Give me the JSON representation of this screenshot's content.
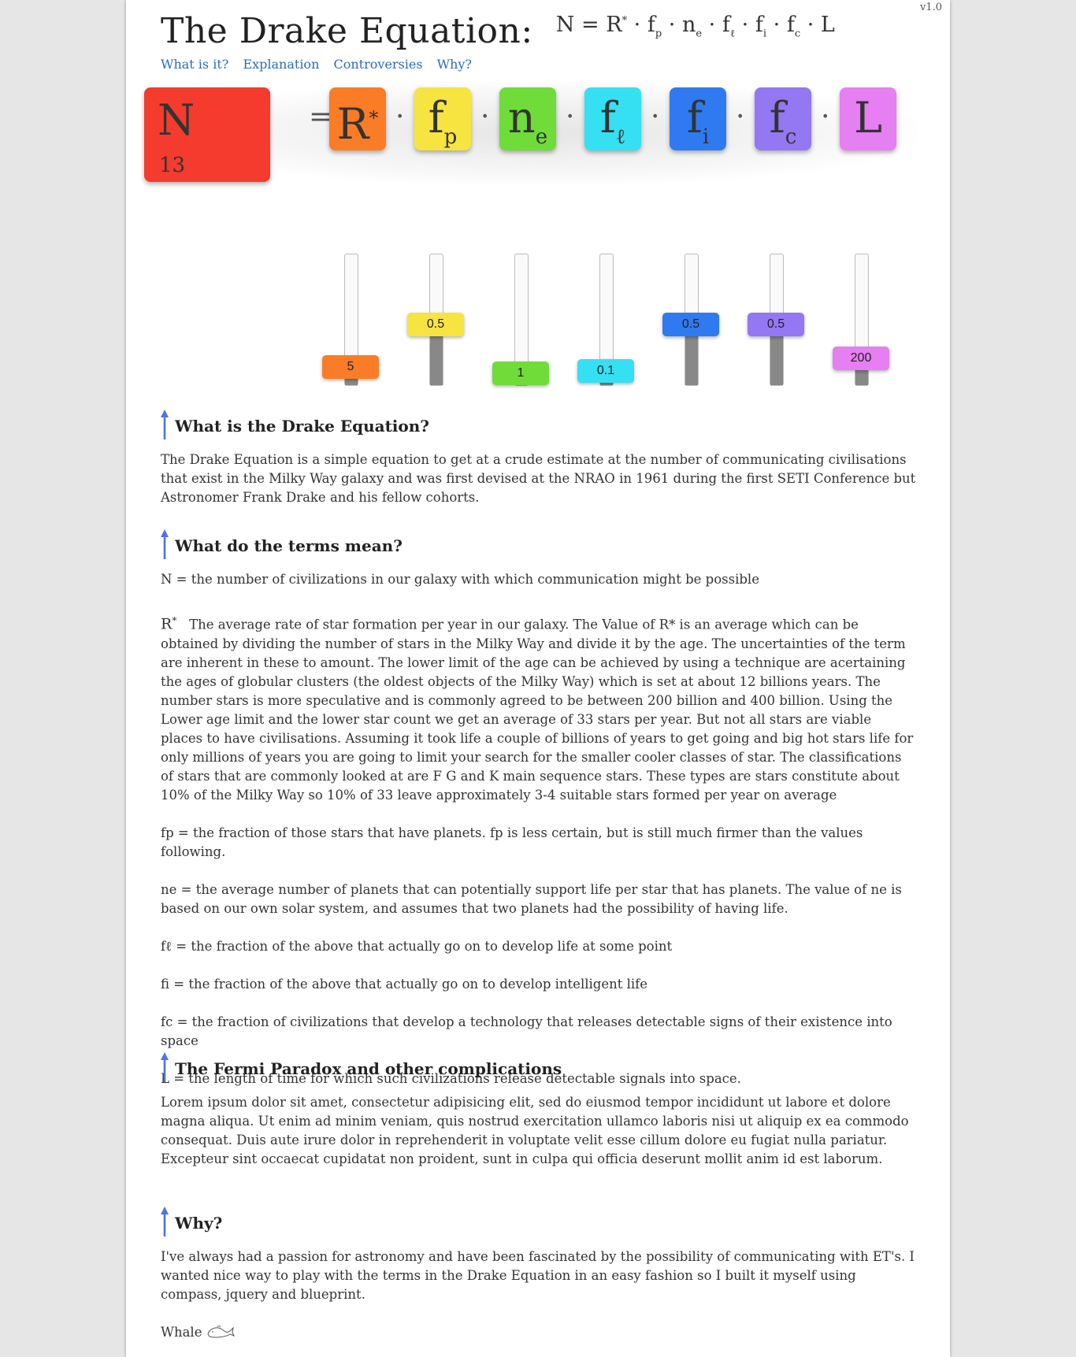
{
  "version": "v1.0",
  "header": {
    "title": "The Drake Equation:",
    "formula": {
      "n": "N",
      "eq": "=",
      "r": "R",
      "star": "*",
      "dot": "·",
      "f": "f",
      "p": "p",
      "nn": "n",
      "e": "e",
      "l": "ℓ",
      "i": "i",
      "c": "c",
      "L": "L"
    }
  },
  "nav": [
    "What is it?",
    "Explanation",
    "Controversies",
    "Why?"
  ],
  "equation": {
    "n_label": "N",
    "n_value": "13",
    "equals": "=",
    "dot": "·",
    "terms": [
      {
        "key": "r",
        "main": "R",
        "sup": "*",
        "sub": "",
        "color": "#fb7c26"
      },
      {
        "key": "fp",
        "main": "f",
        "sup": "",
        "sub": "p",
        "color": "#f7e440"
      },
      {
        "key": "ne",
        "main": "n",
        "sup": "",
        "sub": "e",
        "color": "#6fdc3a"
      },
      {
        "key": "fl",
        "main": "f",
        "sup": "",
        "sub": "ℓ",
        "color": "#34e0f2"
      },
      {
        "key": "fi",
        "main": "f",
        "sup": "",
        "sub": "i",
        "color": "#2f7af0"
      },
      {
        "key": "fc",
        "main": "f",
        "sup": "",
        "sub": "c",
        "color": "#9477f3"
      },
      {
        "key": "L",
        "main": "L",
        "sup": "",
        "sub": "",
        "color": "#e57ff2"
      }
    ]
  },
  "sliders": [
    {
      "key": "r",
      "value": "5",
      "color": "#fb7c26",
      "level": 0.06
    },
    {
      "key": "fp",
      "value": "0.5",
      "color": "#f7e440",
      "level": 0.45
    },
    {
      "key": "ne",
      "value": "1",
      "color": "#6fdc3a",
      "level": 0.0
    },
    {
      "key": "fl",
      "value": "0.1",
      "color": "#34e0f2",
      "level": 0.02
    },
    {
      "key": "fi",
      "value": "0.5",
      "color": "#2f7af0",
      "level": 0.45
    },
    {
      "key": "fc",
      "value": "0.5",
      "color": "#9477f3",
      "level": 0.45
    },
    {
      "key": "L",
      "value": "200",
      "color": "#e57ff2",
      "level": 0.14
    }
  ],
  "sections": {
    "what": {
      "heading": "What is the Drake Equation?",
      "body": "The Drake Equation is a simple equation to get at a crude estimate at the number of communicating civilisations that exist in the Milky Way galaxy and was first devised at the NRAO in 1961 during the first SETI Conference but Astronomer Frank Drake and his fellow cohorts."
    },
    "terms": {
      "heading": "What do the terms mean?",
      "n": "N = the number of civilizations in our galaxy with which communication might be possible",
      "r_symbol": "R",
      "r_star": "*",
      "r": "The average rate of star formation per year in our galaxy. The Value of R* is an average which can be obtained by dividing the number of stars in the Milky Way and divide it by the age. The uncertainties of the term are inherent in these to amount. The lower limit of the age can be achieved by using a technique are acertaining the ages of globular clusters (the oldest objects of the Milky Way) which is set at about 12 billions years. The number stars is more speculative and is commonly agreed to be between 200 billion and 400 billion. Using the Lower age limit and the lower star count we get an average of 33 stars per year. But not all stars are viable places to have civilisations. Assuming it took life a couple of billions of years to get going and big hot stars life for only millions of years you are going to limit your search for the smaller cooler classes of star. The classifications of stars that are commonly looked at are F G and K main sequence stars. These types are stars constitute about 10% of the Milky Way so 10% of 33 leave approximately 3-4 suitable stars formed per year on average",
      "fp": "fp = the fraction of those stars that have planets. fp is less certain, but is still much firmer than the values following.",
      "ne": "ne = the average number of planets that can potentially support life per star that has planets. The value of ne is based on our own solar system, and assumes that two planets had the possibility of having life.",
      "fl": "fℓ = the fraction of the above that actually go on to develop life at some point",
      "fi": "fi = the fraction of the above that actually go on to develop intelligent life",
      "fc": "fc = the fraction of civilizations that develop a technology that releases detectable signs of their existence into space",
      "L": "L = the length of time for which such civilizations release detectable signals into space."
    },
    "fermi": {
      "heading": "The Fermi Paradox and other complications",
      "body": "Lorem ipsum dolor sit amet, consectetur adipisicing elit, sed do eiusmod tempor incididunt ut labore et dolore magna aliqua. Ut enim ad minim veniam, quis nostrud exercitation ullamco laboris nisi ut aliquip ex ea commodo consequat. Duis aute irure dolor in reprehenderit in voluptate velit esse cillum dolore eu fugiat nulla pariatur. Excepteur sint occaecat cupidatat non proident, sunt in culpa qui officia deserunt mollit anim id est laborum."
    },
    "why": {
      "heading": "Why?",
      "body": "I've always had a passion for astronomy and have been fascinated by the possibility of communicating with ET's. I wanted nice way to play with the terms in the Drake Equation in an easy fashion so I built it myself using compass, jquery and blueprint.",
      "signature": "Whale"
    }
  },
  "colors": {
    "n_tile": "#f43b2d",
    "link": "#2a6bbf",
    "arrow": "#4f72e8"
  }
}
